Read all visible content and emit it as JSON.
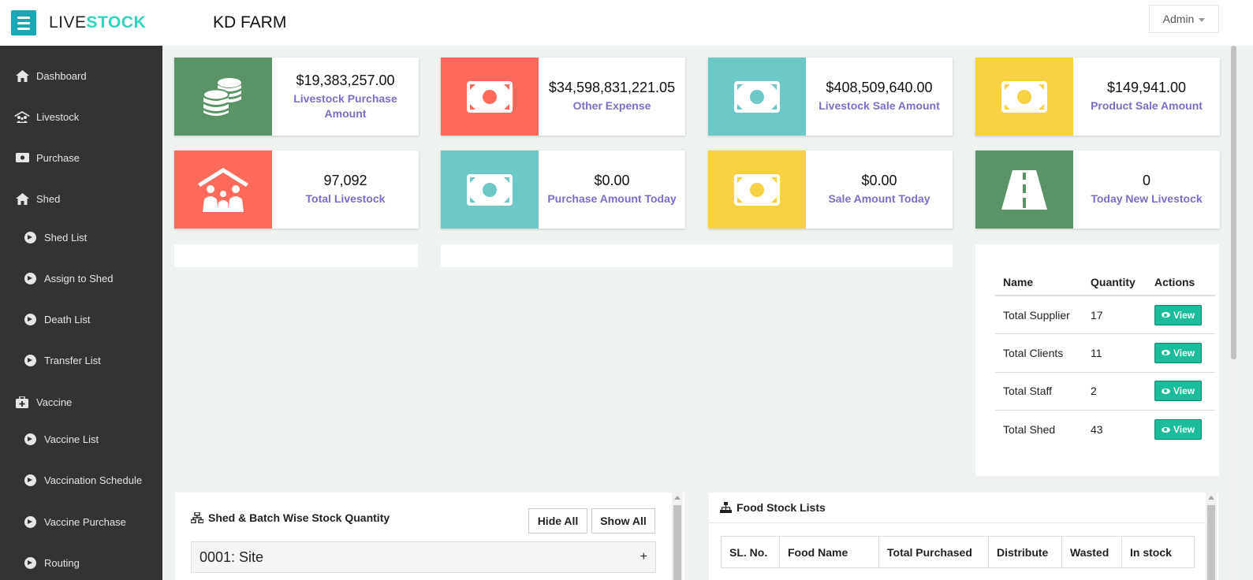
{
  "header": {
    "brand_part1": "LIVE",
    "brand_part2": "STOCK",
    "farm_name": "KD FARM",
    "user_menu": "Admin",
    "accent_color": "#1aa8b4"
  },
  "sidebar": {
    "items": [
      {
        "label": "Dashboard",
        "icon": "home-icon"
      },
      {
        "label": "Livestock",
        "icon": "livestock-icon"
      },
      {
        "label": "Purchase",
        "icon": "money-icon"
      },
      {
        "label": "Shed",
        "icon": "home-icon"
      },
      {
        "label": "Shed List",
        "icon": "circle-arrow-icon"
      },
      {
        "label": "Assign to Shed",
        "icon": "circle-arrow-icon"
      },
      {
        "label": "Death List",
        "icon": "circle-arrow-icon"
      },
      {
        "label": "Transfer List",
        "icon": "circle-arrow-icon"
      },
      {
        "label": "Vaccine",
        "icon": "medkit-icon"
      },
      {
        "label": "Vaccine List",
        "icon": "circle-arrow-icon"
      },
      {
        "label": "Vaccination Schedule",
        "icon": "circle-arrow-icon"
      },
      {
        "label": "Vaccine Purchase",
        "icon": "circle-arrow-icon"
      },
      {
        "label": "Routing",
        "icon": "circle-arrow-icon"
      }
    ]
  },
  "stats": [
    {
      "value": "$19,383,257.00",
      "label": "Livestock Purchase Amount",
      "icon": "coins-icon",
      "color": "#5a9466"
    },
    {
      "value": "$34,598,831,221.05",
      "label": "Other Expense",
      "icon": "money-icon",
      "color": "#fe6b5c"
    },
    {
      "value": "$408,509,640.00",
      "label": "Livestock Sale Amount",
      "icon": "money-icon",
      "color": "#6cc9c7"
    },
    {
      "value": "$149,941.00",
      "label": "Product Sale Amount",
      "icon": "money-icon",
      "color": "#f8d143"
    },
    {
      "value": "97,092",
      "label": "Total Livestock",
      "icon": "family-house-icon",
      "color": "#fe6b5c"
    },
    {
      "value": "$0.00",
      "label": "Purchase Amount Today",
      "icon": "money-icon",
      "color": "#6cc9c7"
    },
    {
      "value": "$0.00",
      "label": "Sale Amount Today",
      "icon": "money-icon",
      "color": "#f8d143"
    },
    {
      "value": "0",
      "label": "Today New Livestock",
      "icon": "road-icon",
      "color": "#5a9466"
    }
  ],
  "summary": {
    "headers": [
      "Name",
      "Quantity",
      "Actions"
    ],
    "rows": [
      {
        "name": "Total Supplier",
        "qty": "17",
        "action": "View"
      },
      {
        "name": "Total Clients",
        "qty": "11",
        "action": "View"
      },
      {
        "name": "Total Staff",
        "qty": "2",
        "action": "View"
      },
      {
        "name": "Total Shed",
        "qty": "43",
        "action": "View"
      }
    ]
  },
  "shed_panel": {
    "title": "Shed & Batch Wise Stock Quantity",
    "hide_all": "Hide All",
    "show_all": "Show All",
    "accordion_item": "0001: Site",
    "expand_symbol": "+"
  },
  "food_panel": {
    "title": "Food Stock Lists",
    "headers": [
      "SL. No.",
      "Food Name",
      "Total Purchased",
      "Distribute",
      "Wasted",
      "In stock"
    ]
  }
}
